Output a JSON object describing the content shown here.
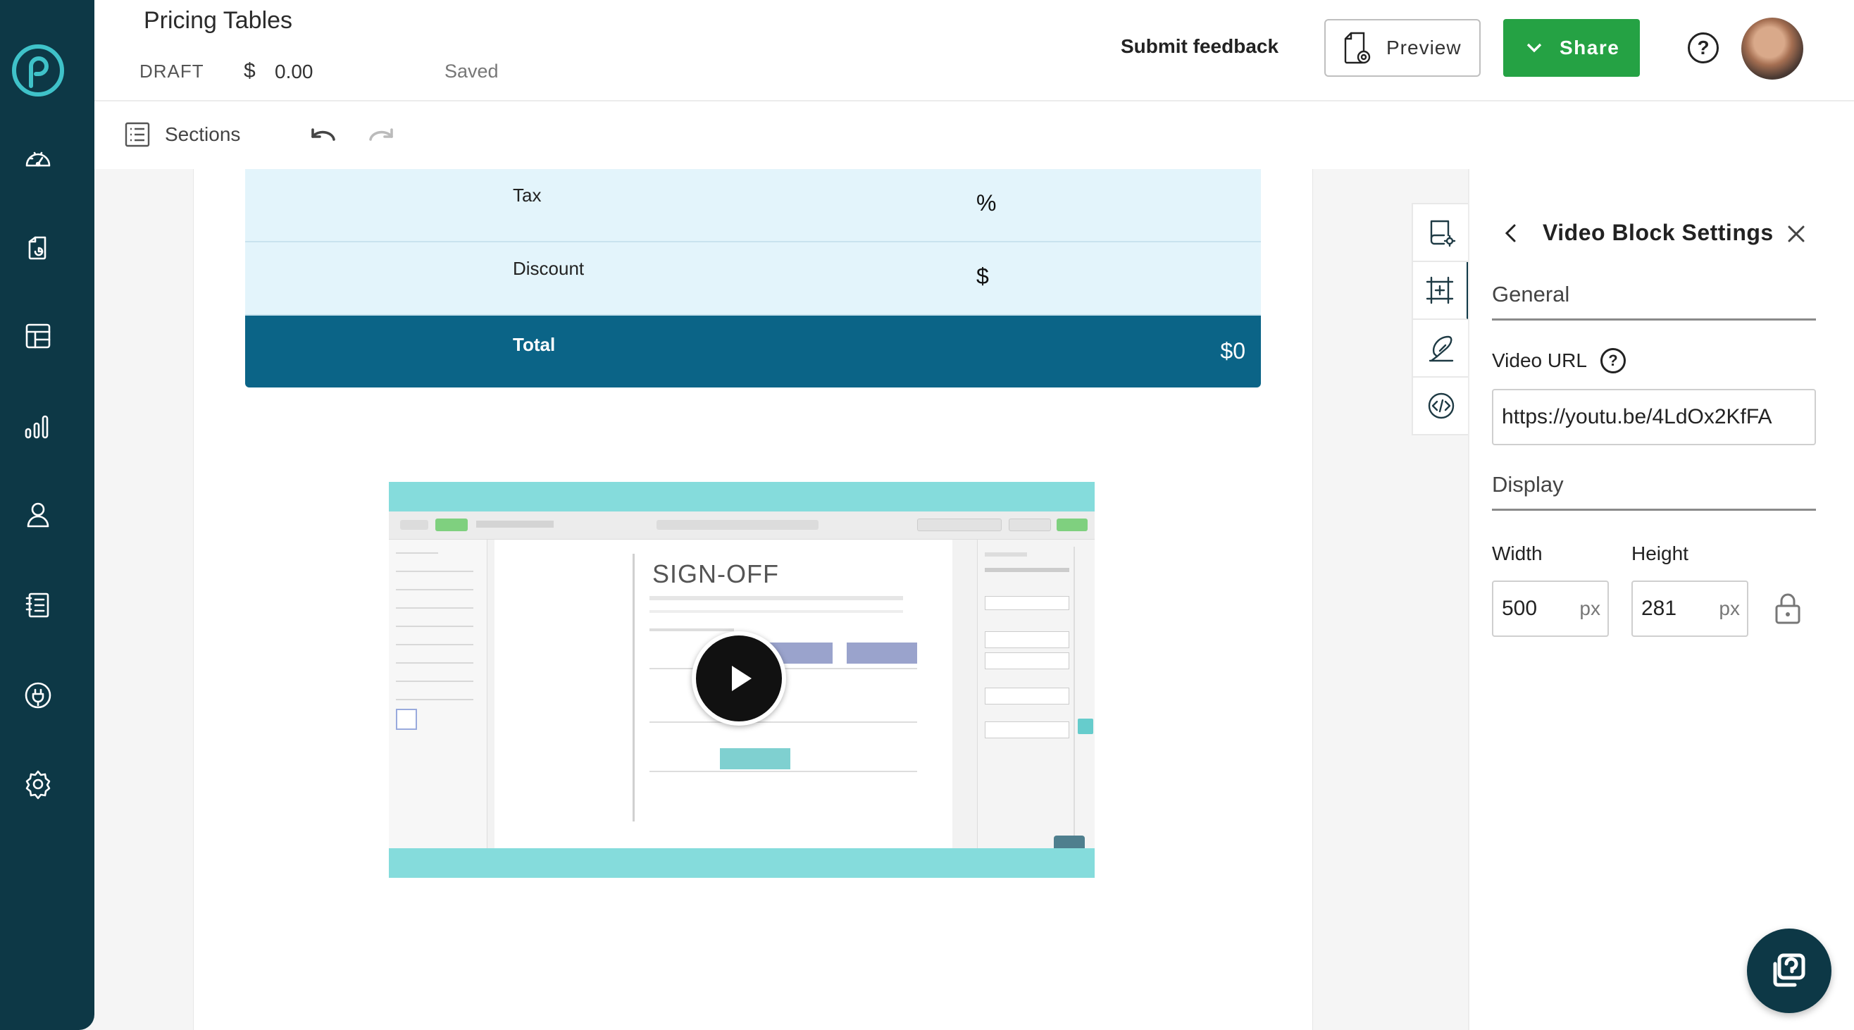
{
  "header": {
    "title": "Pricing Tables",
    "status": "DRAFT",
    "currency_symbol": "$",
    "amount": "0.00",
    "save_state": "Saved",
    "submit_feedback": "Submit feedback",
    "preview_label": "Preview",
    "share_label": "Share",
    "help_label": "?"
  },
  "toolbar": {
    "sections_label": "Sections"
  },
  "sidebar": {
    "items": [
      "dashboard-icon",
      "documents-icon",
      "templates-icon",
      "reports-icon",
      "contacts-icon",
      "catalog-icon",
      "integrations-icon",
      "settings-icon"
    ]
  },
  "pricing_table": {
    "rows": [
      {
        "label": "Tax",
        "value": "%"
      },
      {
        "label": "Discount",
        "value": "$"
      }
    ],
    "total": {
      "label": "Total",
      "value": "$0"
    }
  },
  "video": {
    "embedded_title": "SIGN-OFF"
  },
  "panel": {
    "title": "Video Block Settings",
    "general_label": "General",
    "video_url_label": "Video URL",
    "video_url_value": "https://youtu.be/4LdOx2KfFA",
    "display_label": "Display",
    "width_label": "Width",
    "width_value": "500",
    "height_label": "Height",
    "height_value": "281",
    "unit": "px",
    "help_label": "?"
  },
  "colors": {
    "sidebar": "#0d3846",
    "share": "#25a244",
    "total_row": "#0b6487",
    "table_row": "#e3f4fb",
    "video_frame": "#85dcdc"
  }
}
